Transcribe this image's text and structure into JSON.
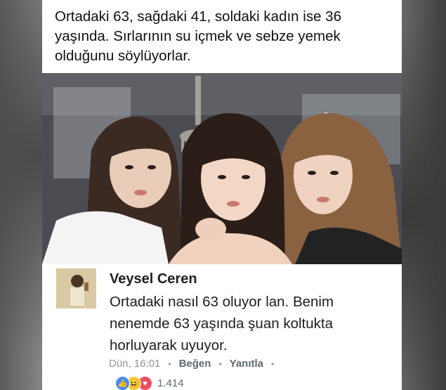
{
  "post": {
    "text": "Ortadaki 63, sağdaki 41, soldaki kadın ise 36 yaşında. Sırlarının su içmek ve sebze yemek olduğunu söylüyorlar."
  },
  "comment": {
    "author": "Veysel Ceren",
    "text": "Ortadaki nasıl 63 oluyor lan. Benim nenemde 63 yaşında şuan koltukta horluyarak uyuyor.",
    "time": "Dün, 16:01",
    "separator": "•",
    "like_label": "Beğen",
    "reply_label": "Yanıtla",
    "reaction_count": "1.414",
    "reactions": [
      "like",
      "haha",
      "love"
    ]
  },
  "icons": {
    "like": "👍",
    "haha": "😆",
    "love": "♥"
  },
  "colors": {
    "link_blue": "#4b8cf5",
    "meta_gray": "#90949c",
    "love_red": "#ee4d5f",
    "haha_yellow": "#f7c531"
  }
}
